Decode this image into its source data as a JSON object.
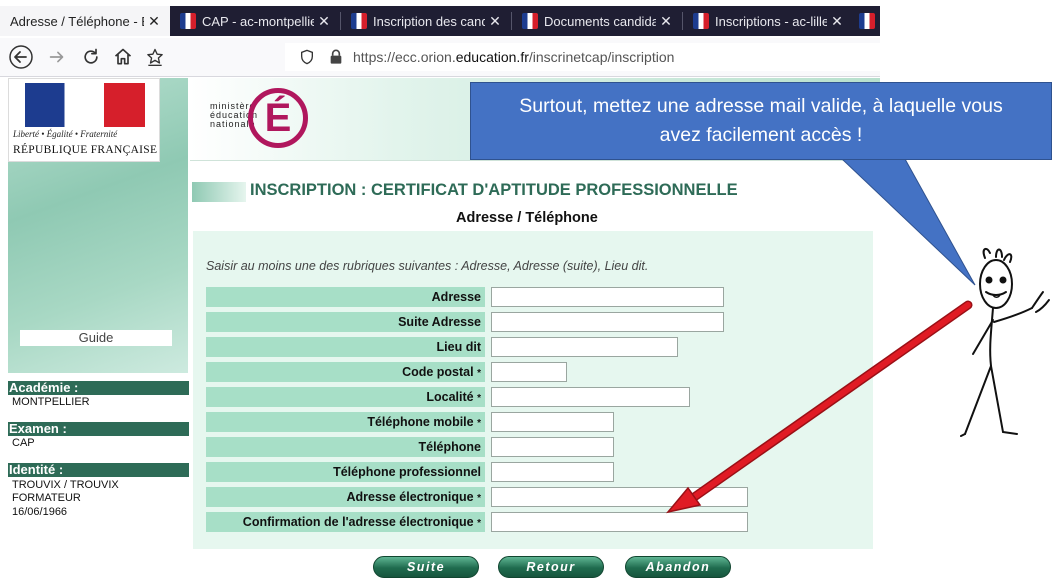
{
  "browser": {
    "tabs": [
      {
        "title": "Adresse / Téléphone - E",
        "active": true
      },
      {
        "title": "CAP - ac-montpellier",
        "active": false
      },
      {
        "title": "Inscription des cand",
        "active": false
      },
      {
        "title": "Documents candida",
        "active": false
      },
      {
        "title": "Inscriptions - ac-lille",
        "active": false
      }
    ],
    "close_glyph": "✕",
    "url_prefix": "https://ecc.orion.",
    "url_domain": "education.fr",
    "url_path": "/inscrinetcap/inscription",
    "icons": [
      "back-icon",
      "forward-icon",
      "reload-icon",
      "home-icon",
      "bookmark-star-icon",
      "shield-icon",
      "lock-icon"
    ]
  },
  "sidebar": {
    "devise": "Liberté • Égalité • Fraternité",
    "republique": "RÉPUBLIQUE FRANÇAISE",
    "guide_label": "Guide",
    "academie_label": "Académie :",
    "academie_value": "MONTPELLIER",
    "examen_label": "Examen :",
    "examen_value": "CAP",
    "identite_label": "Identité :",
    "identite_name": "TROUVIX / TROUVIX",
    "identite_first": "FORMATEUR",
    "identite_date": "16/06/1966"
  },
  "header": {
    "ministry_line1": "ministère",
    "ministry_line2": "éducation",
    "ministry_line3": "nationale",
    "logo_letter": "É"
  },
  "page": {
    "title": "INSCRIPTION : CERTIFICAT D'APTITUDE PROFESSIONNELLE",
    "subtitle": "Adresse / Téléphone",
    "instruction": "Saisir au moins une des rubriques suivantes : Adresse, Adresse (suite), Lieu dit."
  },
  "form": {
    "required_mark": "*",
    "fields": [
      {
        "label": "Adresse",
        "required": false,
        "value": ""
      },
      {
        "label": "Suite Adresse",
        "required": false,
        "value": ""
      },
      {
        "label": "Lieu dit",
        "required": false,
        "value": ""
      },
      {
        "label": "Code postal",
        "required": true,
        "value": ""
      },
      {
        "label": "Localité",
        "required": true,
        "value": ""
      },
      {
        "label": "Téléphone mobile",
        "required": true,
        "value": ""
      },
      {
        "label": "Téléphone",
        "required": false,
        "value": ""
      },
      {
        "label": "Téléphone professionnel",
        "required": false,
        "value": ""
      },
      {
        "label": "Adresse électronique",
        "required": true,
        "value": ""
      },
      {
        "label": "Confirmation de l'adresse électronique",
        "required": true,
        "value": ""
      }
    ]
  },
  "buttons": {
    "suite": "Suite",
    "retour": "Retour",
    "abandon": "Abandon"
  },
  "callout": {
    "line1": "Surtout, mettez une adresse mail valide, à laquelle vous",
    "line2": "avez facilement accès !",
    "color": "#4472c4",
    "arrow_color": "#e01b24"
  }
}
